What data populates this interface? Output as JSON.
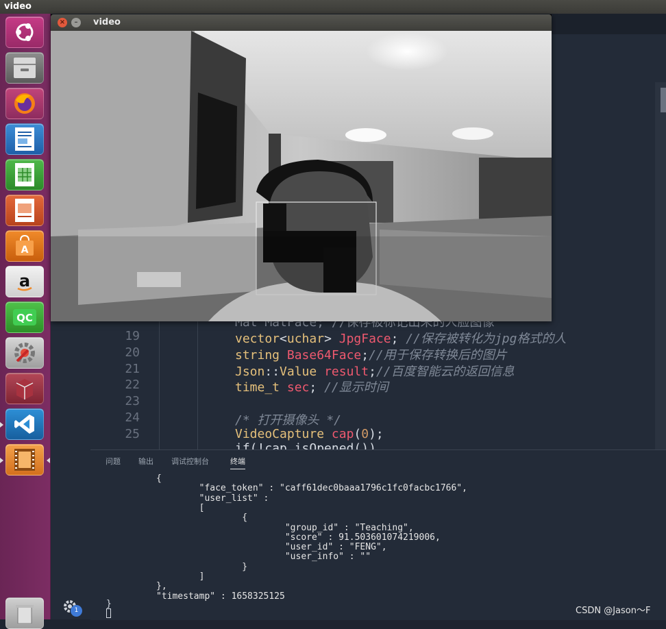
{
  "app_title": "video",
  "video_window": {
    "title": "video"
  },
  "code": {
    "partial_top": "Mat MatFace; //保存被标记出来的人脸图像",
    "lines": [
      {
        "n": "19",
        "parts": [
          [
            "ty",
            "vector"
          ],
          [
            "pl",
            "<"
          ],
          [
            "ty",
            "uchar"
          ],
          [
            "pl",
            "> "
          ],
          [
            "id",
            "JpgFace"
          ],
          [
            "pl",
            "; "
          ],
          [
            "cm",
            "//保存被转化为jpg格式的人"
          ]
        ]
      },
      {
        "n": "20",
        "parts": [
          [
            "ty",
            "string"
          ],
          [
            "pl",
            " "
          ],
          [
            "id",
            "Base64Face"
          ],
          [
            "pl",
            ";"
          ],
          [
            "cm",
            "//用于保存转换后的图片"
          ]
        ]
      },
      {
        "n": "21",
        "parts": [
          [
            "ty",
            "Json"
          ],
          [
            "pl",
            "::"
          ],
          [
            "ty",
            "Value"
          ],
          [
            "pl",
            " "
          ],
          [
            "id",
            "result"
          ],
          [
            "pl",
            ";"
          ],
          [
            "cm",
            "//百度智能云的返回信息"
          ]
        ]
      },
      {
        "n": "22",
        "parts": [
          [
            "ty",
            "time_t"
          ],
          [
            "pl",
            " "
          ],
          [
            "id",
            "sec"
          ],
          [
            "pl",
            "; "
          ],
          [
            "cm",
            "//显示时间"
          ]
        ]
      },
      {
        "n": "23",
        "parts": []
      },
      {
        "n": "24",
        "parts": [
          [
            "cm",
            "/* 打开摄像头 */"
          ]
        ]
      },
      {
        "n": "25",
        "parts": [
          [
            "ty",
            "VideoCapture"
          ],
          [
            "pl",
            " "
          ],
          [
            "fn",
            "cap"
          ],
          [
            "pl",
            "("
          ],
          [
            "nm",
            "0"
          ],
          [
            "pl",
            ");"
          ]
        ]
      }
    ],
    "partial_bottom": "if(!cap.isOpened())"
  },
  "panel_tabs": [
    "问题",
    "输出",
    "调试控制台",
    "终端"
  ],
  "terminal_lines": [
    "{",
    "        \"face_token\" : \"caff61dec0baaa1796c1fc0facbc1766\",",
    "        \"user_list\" :",
    "        [",
    "                {",
    "                        \"group_id\" : \"Teaching\",",
    "                        \"score\" : 91.503601074219006,",
    "                        \"user_id\" : \"FENG\",",
    "                        \"user_info\" : \"\"",
    "                }",
    "        ]",
    "},",
    "\"timestamp\" : 1658325125"
  ],
  "terminal_tail": "}",
  "settings_badge": "1",
  "watermark": "CSDN @Jason～F"
}
